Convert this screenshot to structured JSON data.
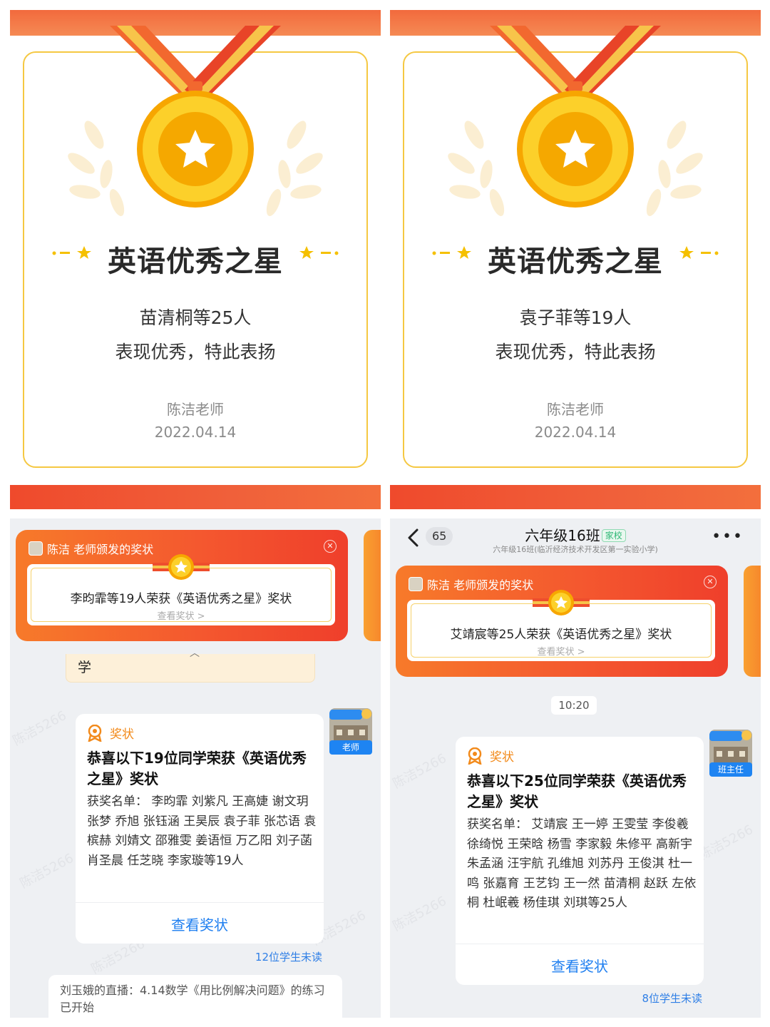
{
  "certificates": [
    {
      "title": "英语优秀之星",
      "recipients": "苗清桐等25人",
      "praise": "表现优秀，特此表扬",
      "teacher": "陈洁老师",
      "date": "2022.04.14"
    },
    {
      "title": "英语优秀之星",
      "recipients": "袁子菲等19人",
      "praise": "表现优秀，特此表扬",
      "teacher": "陈洁老师",
      "date": "2022.04.14"
    }
  ],
  "chat_left": {
    "banner": {
      "header": "陈洁 老师颁发的奖状",
      "text": "李昀霏等19人荣获《英语优秀之星》奖状",
      "link": "查看奖状 >"
    },
    "previous_bubble": "学",
    "message": {
      "type_label": "奖状",
      "title": "恭喜以下19位同学荣获《英语优秀之星》奖状",
      "body": "获奖名单：  李昀霏  刘紫凡  王高婕  谢文玥  张梦  乔旭  张钰涵  王昊辰  袁子菲  张芯语  袁槟赫  刘婧文  邵雅雯  姜语恒  万乙阳  刘子菡  肖圣晨  任芝晓  李家璇等19人",
      "action": "查看奖状",
      "role": "老师",
      "unread": "12位学生未读"
    },
    "live_note": "刘玉娥的直播：4.14数学《用比例解决问题》的练习 已开始",
    "watermark": "陈洁5266"
  },
  "chat_right": {
    "header": {
      "back_count": "65",
      "title": "六年级16班",
      "tag": "家校",
      "subtitle": "六年级16班(临沂经济技术开发区第一实验小学)",
      "more": "•••"
    },
    "banner": {
      "header": "陈洁 老师颁发的奖状",
      "text": "艾靖宸等25人荣获《英语优秀之星》奖状",
      "link": "查看奖状 >"
    },
    "time": "10:20",
    "message": {
      "type_label": "奖状",
      "title": "恭喜以下25位同学荣获《英语优秀之星》奖状",
      "body": "获奖名单：  艾靖宸  王一婷  王雯莹  李俊羲  徐绮悦  王荣晗  杨雪  李家毅  朱修平  高新宇  朱孟涵  汪宇航  孔维旭  刘苏丹  王俊淇  杜一鸣  张嘉育  王艺钧  王一然  苗清桐  赵跃  左依桐  杜岷羲  杨佳琪  刘琪等25人",
      "action": "查看奖状",
      "role": "班主任",
      "unread": "8位学生未读"
    },
    "watermark": "陈洁5266"
  },
  "colors": {
    "accent_orange": "#f4582f",
    "gold": "#f7b500",
    "link_blue": "#1f7ff0"
  }
}
